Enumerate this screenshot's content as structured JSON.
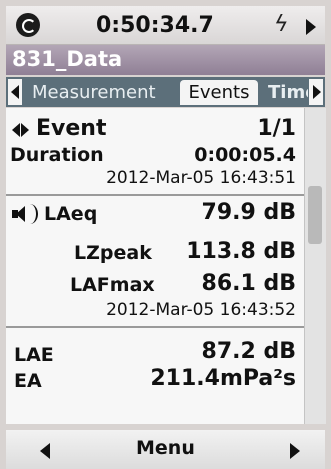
{
  "status": {
    "time": "0:50:34.7",
    "clock_icon": "clock-icon",
    "power_icon": "flash-icon",
    "power_glyph": "ϟ"
  },
  "title": "831_Data",
  "tabs": [
    {
      "label": "Measurement"
    },
    {
      "label": "Events"
    },
    {
      "label": "Time"
    }
  ],
  "event": {
    "label": "Event",
    "counter": "1/1",
    "duration_label": "Duration",
    "duration_value": "0:00:05.4",
    "start_timestamp": "2012-Mar-05 16:43:51"
  },
  "levels": {
    "laeq_label": "LAeq",
    "laeq_value": "79.9 dB",
    "lzpeak_label": "LZpeak",
    "lzpeak_value": "113.8 dB",
    "lafmax_label": "LAFmax",
    "lafmax_value": "86.1 dB",
    "lafmax_timestamp": "2012-Mar-05 16:43:52"
  },
  "exposure": {
    "lae_label": "LAE",
    "lae_value": "87.2 dB",
    "ea_label": "EA",
    "ea_value": "211.4mPa²s"
  },
  "footer": {
    "menu_label": "Menu"
  }
}
